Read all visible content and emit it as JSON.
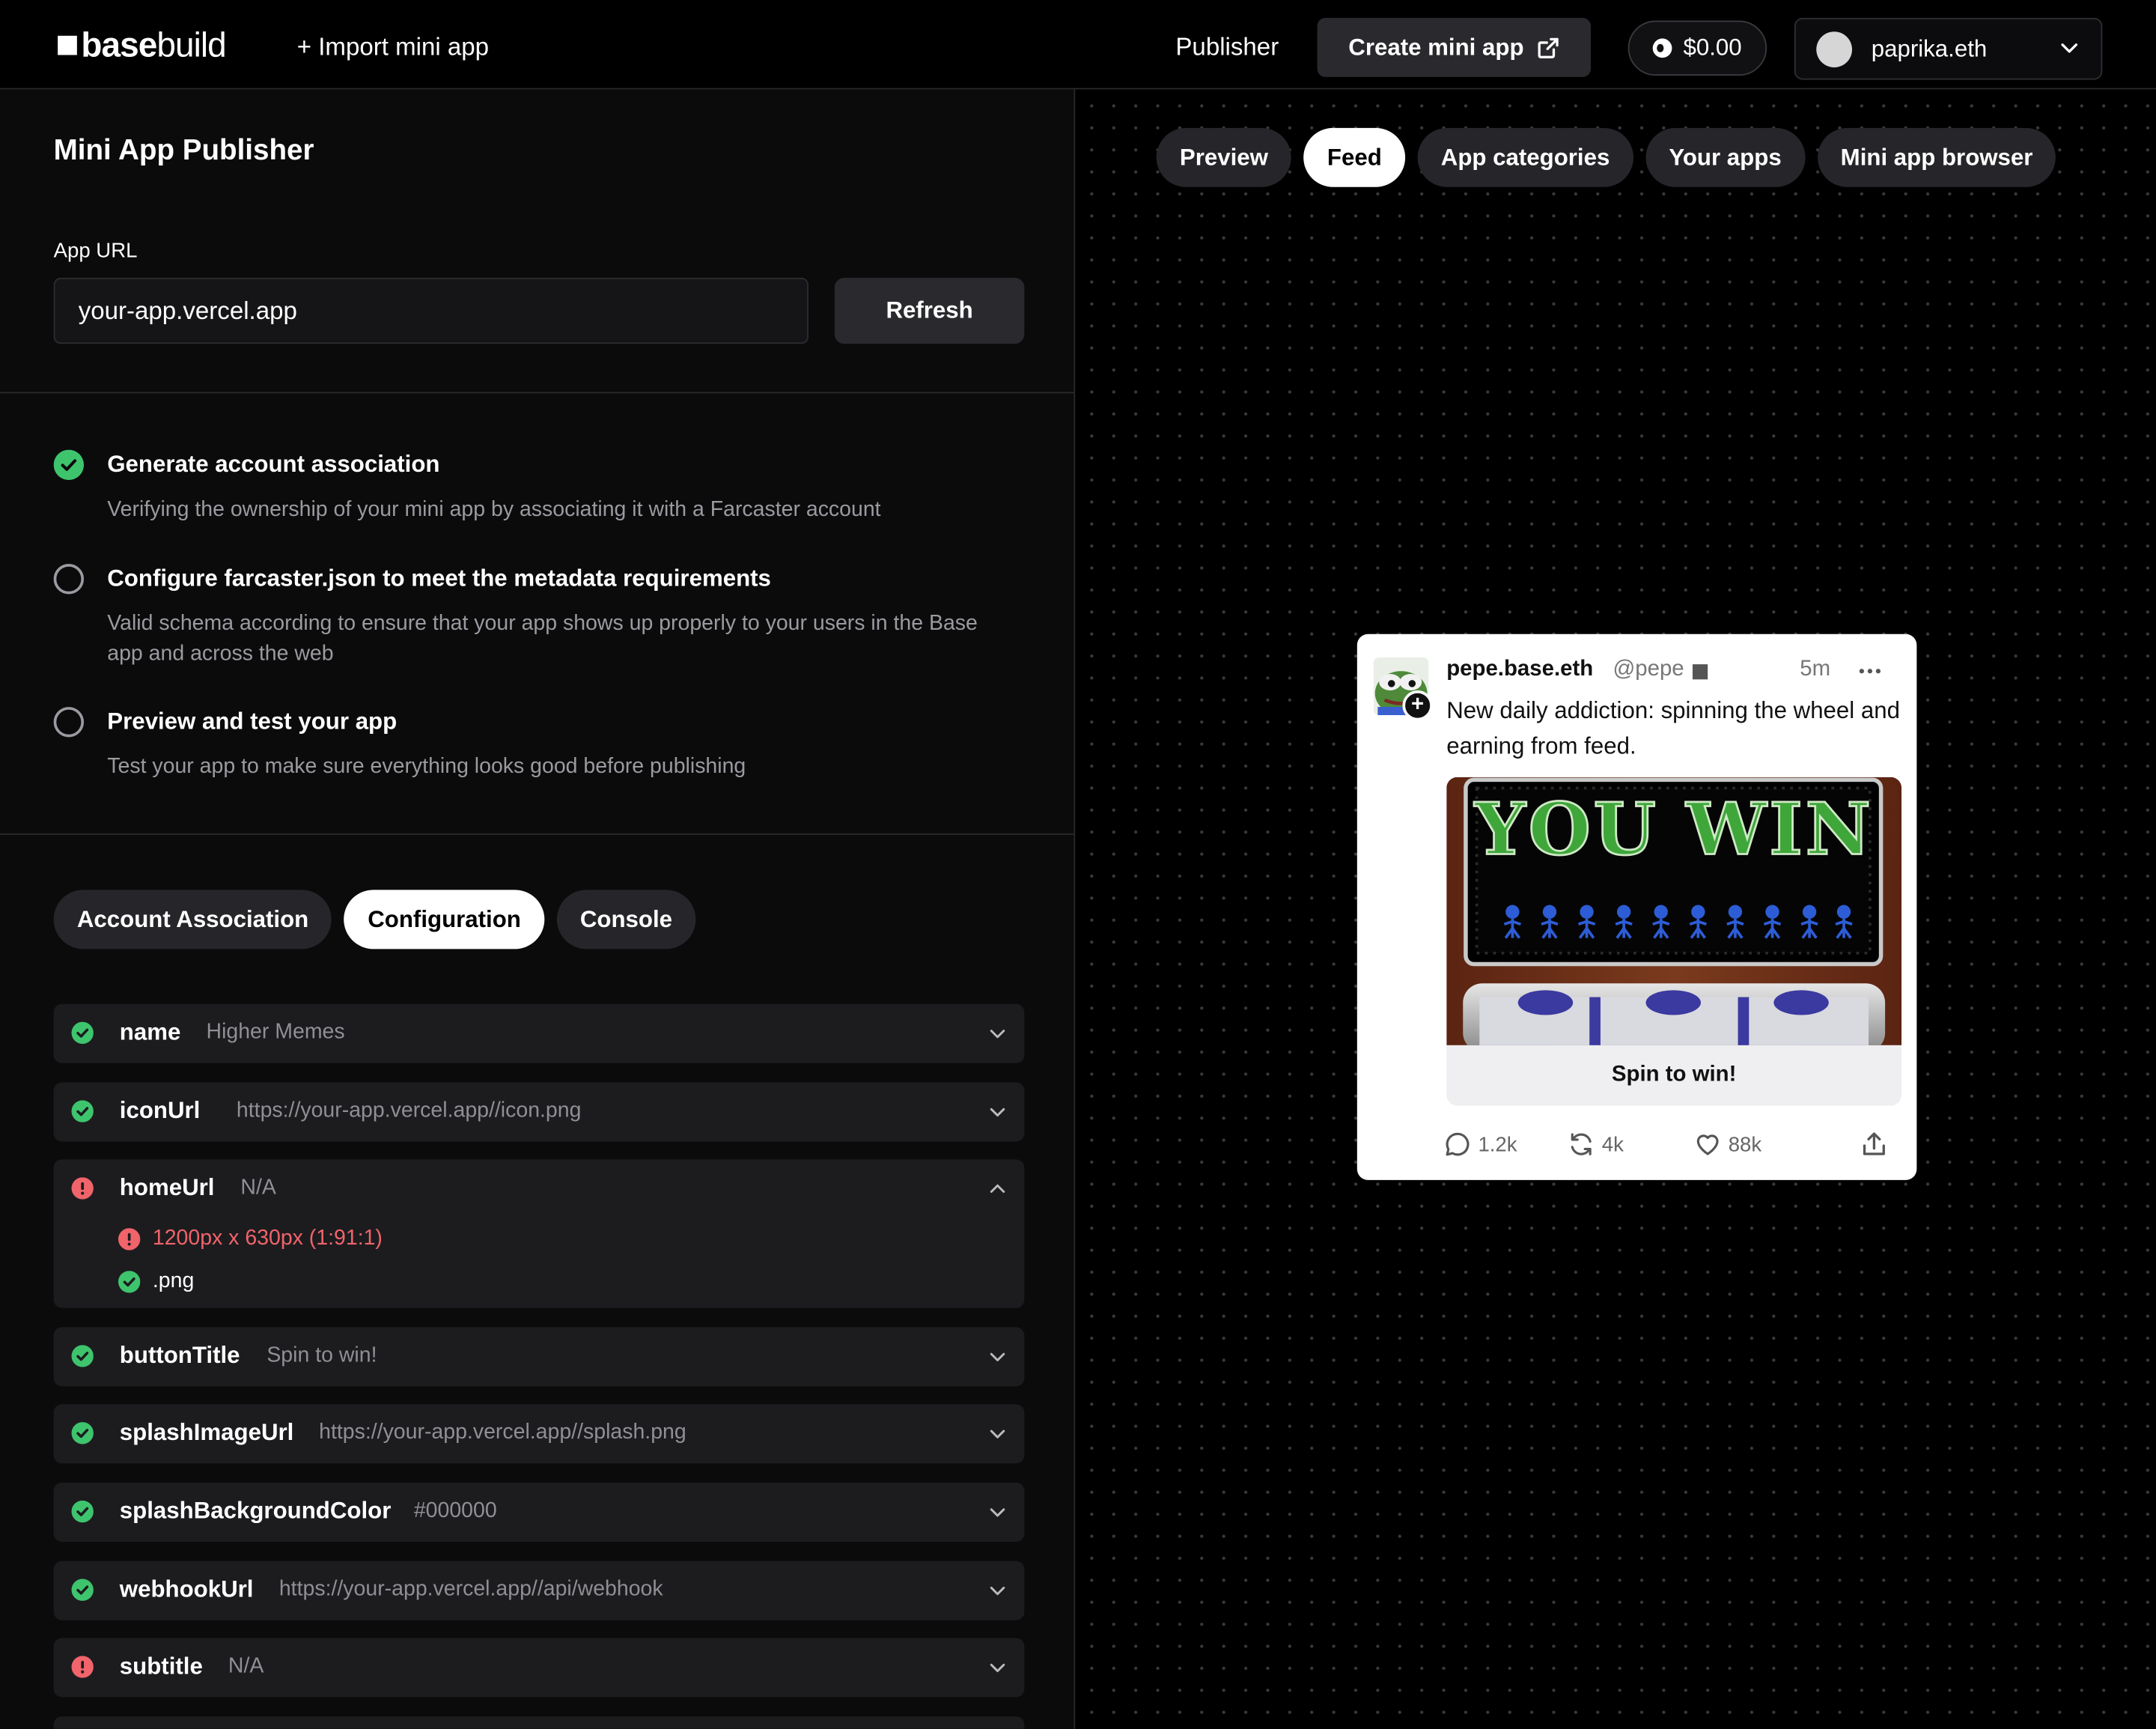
{
  "topbar": {
    "logo_bold": "base",
    "logo_light": "build",
    "import_label": "+ Import mini app",
    "publisher_label": "Publisher",
    "create_label": "Create mini app",
    "balance": "$0.00",
    "account_name": "paprika.eth"
  },
  "publisher": {
    "title": "Mini App Publisher",
    "url_label": "App URL",
    "url_value": "your-app.vercel.app",
    "refresh_label": "Refresh",
    "steps": [
      {
        "title": "Generate account association",
        "desc": "Verifying the ownership of your mini app by associating it with a Farcaster account",
        "status": "done"
      },
      {
        "title": "Configure farcaster.json to meet the metadata requirements",
        "desc": "Valid schema according to ensure that your app shows up properly to your users in the Base app and across the web",
        "status": "pending"
      },
      {
        "title": "Preview and test your app",
        "desc": "Test your app to make sure everything looks good before publishing",
        "status": "pending"
      }
    ],
    "tabs": [
      "Account Association",
      "Configuration",
      "Console"
    ],
    "active_tab": "Configuration",
    "fields": [
      {
        "key": "name",
        "value": "Higher Memes",
        "status": "ok"
      },
      {
        "key": "iconUrl",
        "value": "https://your-app.vercel.app//icon.png",
        "status": "ok"
      },
      {
        "key": "homeUrl",
        "value": "N/A",
        "status": "error",
        "expanded": true,
        "checks": [
          {
            "text": "1200px x 630px (1:91:1)",
            "status": "error"
          },
          {
            "text": ".png",
            "status": "ok"
          }
        ]
      },
      {
        "key": "buttonTitle",
        "value": "Spin to win!",
        "status": "ok"
      },
      {
        "key": "splashImageUrl",
        "value": "https://your-app.vercel.app//splash.png",
        "status": "ok"
      },
      {
        "key": "splashBackgroundColor",
        "value": "#000000",
        "status": "ok"
      },
      {
        "key": "webhookUrl",
        "value": "https://your-app.vercel.app//api/webhook",
        "status": "ok"
      },
      {
        "key": "subtitle",
        "value": "N/A",
        "status": "error"
      }
    ]
  },
  "preview": {
    "tabs": [
      "Preview",
      "Feed",
      "App categories",
      "Your apps",
      "Mini app browser"
    ],
    "active_tab": "Feed",
    "cast": {
      "username": "pepe.base.eth",
      "handle": "@pepe",
      "time": "5m",
      "text": "New daily addiction: spinning the wheel and earning from feed.",
      "embed_headline": "YOU WIN",
      "button_label": "Spin to win!",
      "replies": "1.2k",
      "recasts": "4k",
      "likes": "88k"
    }
  },
  "colors": {
    "ok_green": "#3ec46d",
    "error_red": "#f0646a",
    "panel_bg": "#0b0b0c",
    "row_bg": "#1c1c1f"
  },
  "icons": {
    "ok": "check-circle-icon",
    "error": "alert-circle-icon",
    "chevron": "chevron-down-icon",
    "external": "external-link-icon"
  }
}
